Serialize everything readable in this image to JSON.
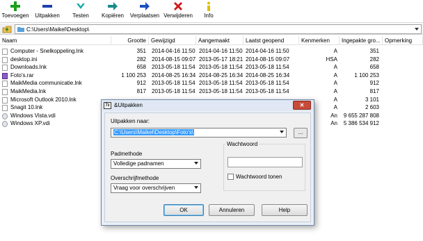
{
  "toolbar": {
    "buttons": [
      {
        "label": "Toevoegen",
        "icon": "plus-icon",
        "color": "#1aa01a"
      },
      {
        "label": "Uitpakken",
        "icon": "minus-icon",
        "color": "#1d3fb0"
      },
      {
        "label": "Testen",
        "icon": "check-icon",
        "color": "#18a8a8"
      },
      {
        "label": "Kopiëren",
        "icon": "copy-arrow-icon",
        "color": "#1a8a8a"
      },
      {
        "label": "Verplaatsen",
        "icon": "move-arrow-icon",
        "color": "#1b4fc0"
      },
      {
        "label": "Verwijderen",
        "icon": "delete-x-icon",
        "color": "#d01818"
      },
      {
        "label": "Info",
        "icon": "info-icon",
        "color": "#e0c000"
      }
    ]
  },
  "address": {
    "path": "C:\\Users\\Maikel\\Desktop\\"
  },
  "columns": [
    "Naam",
    "Grootte",
    "Gewijzigd",
    "Aangemaakt",
    "Laatst geopend",
    "Kenmerken",
    "Ingepakte gro...",
    "Opmerking"
  ],
  "rows": [
    {
      "name": "Computer - Snelkoppeling.lnk",
      "size": "351",
      "modified": "2014-04-16 11:50",
      "created": "2014-04-16 11:50",
      "accessed": "2014-04-16 11:50",
      "attr": "A",
      "packed": "351",
      "icon": "shortcut-file-icon"
    },
    {
      "name": "desktop.ini",
      "size": "282",
      "modified": "2014-08-15 09:07",
      "created": "2013-05-17 18:21",
      "accessed": "2014-08-15 09:07",
      "attr": "HSA",
      "packed": "282",
      "icon": "ini-file-icon"
    },
    {
      "name": "Downloads.lnk",
      "size": "658",
      "modified": "2013-05-18 11:54",
      "created": "2013-05-18 11:54",
      "accessed": "2013-05-18 11:54",
      "attr": "A",
      "packed": "658",
      "icon": "shortcut-file-icon"
    },
    {
      "name": "Foto's.rar",
      "size": "1 100 253",
      "modified": "2014-08-25 16:34",
      "created": "2014-08-25 16:34",
      "accessed": "2014-08-25 16:34",
      "attr": "A",
      "packed": "1 100 253",
      "icon": "archive-file-icon"
    },
    {
      "name": "MaikMedia communicatie.lnk",
      "size": "912",
      "modified": "2013-05-18 11:54",
      "created": "2013-05-18 11:54",
      "accessed": "2013-05-18 11:54",
      "attr": "A",
      "packed": "912",
      "icon": "shortcut-file-icon"
    },
    {
      "name": "MaikMedia.lnk",
      "size": "817",
      "modified": "2013-05-18 11:54",
      "created": "2013-05-18 11:54",
      "accessed": "2013-05-18 11:54",
      "attr": "A",
      "packed": "817",
      "icon": "shortcut-file-icon"
    },
    {
      "name": "Microsoft Outlook 2010.lnk",
      "size": "",
      "modified": "",
      "created": "",
      "accessed": "",
      "attr": "A",
      "packed": "3 101",
      "icon": "shortcut-file-icon"
    },
    {
      "name": "Snagit 10.lnk",
      "size": "",
      "modified": "",
      "created": "",
      "accessed": "",
      "attr": "A",
      "packed": "2 603",
      "icon": "shortcut-file-icon"
    },
    {
      "name": "Windows Vista.vdi",
      "size": "",
      "modified": "",
      "created": "",
      "accessed": "",
      "attr": "An",
      "packed": "9 655 287 808",
      "icon": "disk-image-icon"
    },
    {
      "name": "Windows XP.vdi",
      "size": "",
      "modified": "",
      "created": "",
      "accessed": "",
      "attr": "An",
      "packed": "5 386 534 912",
      "icon": "disk-image-icon"
    }
  ],
  "dialog": {
    "app_icon_text": "7z",
    "title": "&Uitpakken",
    "close_label": "✕",
    "extract_to_label": "Uitpakken naar:",
    "extract_to_value": "C:\\Users\\Maikel\\Desktop\\Foto's\\",
    "browse_label": "...",
    "path_mode_label": "Padmethode",
    "path_mode_value": "Volledige padnamen",
    "overwrite_label": "Overschrijfmethode",
    "overwrite_value": "Vraag voor overschrijven",
    "password_group_label": "Wachtwoord",
    "password_value": "",
    "show_password_label": "Wachtwoord tonen",
    "ok_label": "OK",
    "cancel_label": "Annuleren",
    "help_label": "Help"
  }
}
